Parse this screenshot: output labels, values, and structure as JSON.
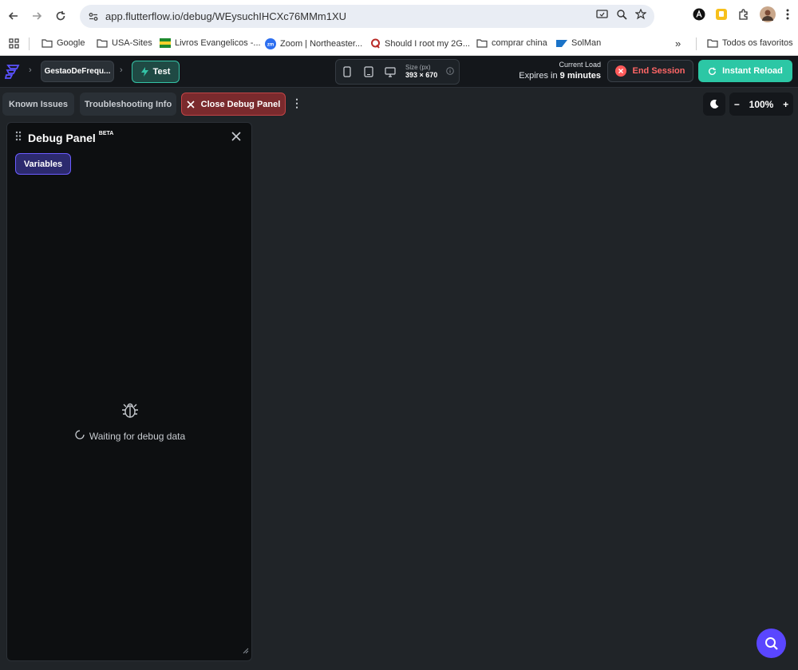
{
  "browser": {
    "url": "app.flutterflow.io/debug/WEysuchIHCXc76MMm1XU",
    "bookmarks": [
      {
        "label": "Google",
        "icon": "folder-icon"
      },
      {
        "label": "USA-Sites",
        "icon": "folder-icon"
      },
      {
        "label": "Livros Evangelicos -...",
        "icon": "flag-icon"
      },
      {
        "label": "Zoom | Northeaster...",
        "icon": "zoom-icon"
      },
      {
        "label": "Should I root my 2G...",
        "icon": "quora-icon"
      },
      {
        "label": "comprar china",
        "icon": "folder-icon"
      },
      {
        "label": "SolMan",
        "icon": "sap-icon"
      }
    ],
    "all_bookmarks_label": "Todos os favoritos"
  },
  "flutterflow": {
    "project_name": "GestaoDeFrequ...",
    "test_label": "Test",
    "size_label": "Size (px)",
    "size_value": "393 × 670",
    "current_load_label": "Current Load",
    "expires_prefix": "Expires in",
    "expires_value": "9 minutes",
    "end_session_label": "End Session",
    "instant_reload_label": "Instant Reload"
  },
  "toolbar": {
    "known_issues_label": "Known Issues",
    "troubleshooting_label": "Troubleshooting Info",
    "close_debug_label": "Close Debug Panel",
    "zoom_level": "100%"
  },
  "debug_panel": {
    "title": "Debug Panel",
    "beta": "BETA",
    "variables_tab": "Variables",
    "waiting_text": "Waiting for debug data"
  },
  "colors": {
    "accent_teal": "#2cc7a5",
    "danger_red": "#ff6666",
    "purple": "#5a46ff"
  }
}
